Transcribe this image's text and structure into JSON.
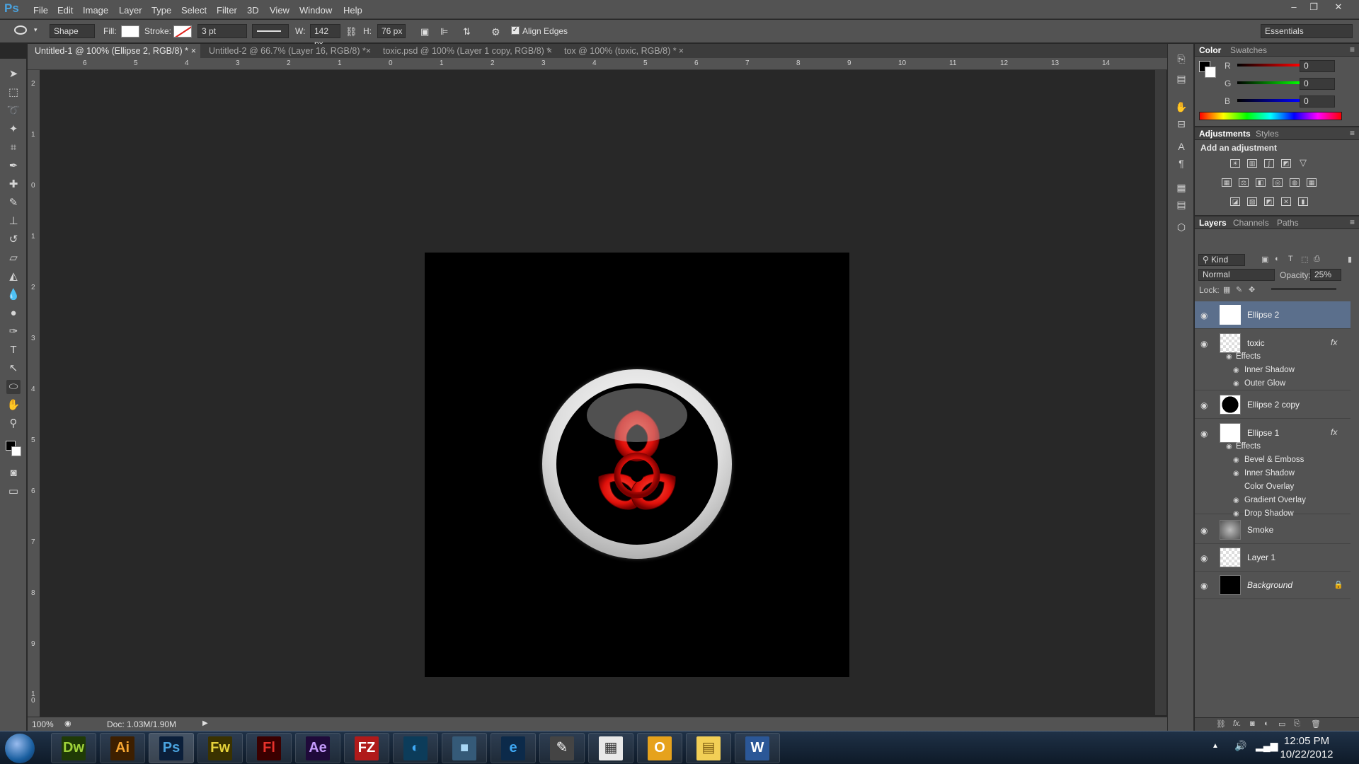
{
  "app": {
    "logo": "Ps",
    "accent": "#4aa3df"
  },
  "menu": [
    "File",
    "Edit",
    "Image",
    "Layer",
    "Type",
    "Select",
    "Filter",
    "3D",
    "View",
    "Window",
    "Help"
  ],
  "window_controls": {
    "minimize": "–",
    "restore": "❐",
    "close": "✕"
  },
  "options": {
    "tool_mode": "Shape",
    "fill_label": "Fill:",
    "stroke_label": "Stroke:",
    "stroke_width": "3 pt",
    "w_label": "W:",
    "width": "142 px",
    "h_label": "H:",
    "height": "76 px",
    "align_edges": "Align Edges",
    "workspace": "Essentials"
  },
  "tabs": [
    {
      "label": "Untitled-1 @ 100% (Ellipse 2, RGB/8) *",
      "active": true
    },
    {
      "label": "Untitled-2 @ 66.7% (Layer 16, RGB/8) *"
    },
    {
      "label": "toxic.psd @ 100% (Layer 1 copy, RGB/8) *"
    },
    {
      "label": "tox @ 100% (toxic, RGB/8) *"
    }
  ],
  "ruler_h": [
    "6",
    "5",
    "4",
    "3",
    "2",
    "1",
    "0",
    "1",
    "2",
    "3",
    "4",
    "5",
    "6",
    "7",
    "8",
    "9",
    "10",
    "11",
    "12",
    "13",
    "14"
  ],
  "ruler_v": [
    "2",
    "1",
    "0",
    "1",
    "2",
    "3",
    "4",
    "5",
    "6",
    "7",
    "8",
    "9",
    "1 0"
  ],
  "status": {
    "zoom": "100%",
    "doc": "Doc: 1.03M/1.90M"
  },
  "color_panel": {
    "tabs": [
      "Color",
      "Swatches"
    ],
    "channels": [
      {
        "label": "R",
        "value": "0"
      },
      {
        "label": "G",
        "value": "0"
      },
      {
        "label": "B",
        "value": "0"
      }
    ]
  },
  "adjustments_panel": {
    "tabs": [
      "Adjustments",
      "Styles"
    ],
    "heading": "Add an adjustment"
  },
  "layers_panel": {
    "tabs": [
      "Layers",
      "Channels",
      "Paths"
    ],
    "filter_kind": "Kind",
    "blend_mode": "Normal",
    "opacity_label": "Opacity:",
    "opacity": "25%",
    "lock_label": "Lock:",
    "layers": [
      {
        "name": "Ellipse 2",
        "selected": true
      },
      {
        "name": "toxic",
        "fx": "fx",
        "effects_label": "Effects",
        "effects": [
          "Inner Shadow",
          "Outer Glow"
        ]
      },
      {
        "name": "Ellipse 2 copy"
      },
      {
        "name": "Ellipse 1",
        "fx": "fx",
        "effects_label": "Effects",
        "effects": [
          "Bevel & Emboss",
          "Inner Shadow",
          "Color Overlay",
          "Gradient Overlay",
          "Drop Shadow"
        ]
      },
      {
        "name": "Smoke"
      },
      {
        "name": "Layer 1"
      },
      {
        "name": "Background"
      }
    ]
  },
  "taskbar": {
    "apps": [
      {
        "icon": "Dw",
        "color": "#9fd23a",
        "bg": "#1f3a06"
      },
      {
        "icon": "Ai",
        "color": "#f7a631",
        "bg": "#3d1f00"
      },
      {
        "icon": "Ps",
        "color": "#4aa3df",
        "bg": "#0b1f3a"
      },
      {
        "icon": "Fw",
        "color": "#e6d23b",
        "bg": "#3a3200"
      },
      {
        "icon": "Fl",
        "color": "#e8322b",
        "bg": "#3a0000"
      },
      {
        "icon": "Ae",
        "color": "#c49bfb",
        "bg": "#1f0a3a"
      },
      {
        "icon": "FZ",
        "color": "#ffffff",
        "bg": "#b01a1a"
      },
      {
        "icon": "◐",
        "color": "#3fa9f5",
        "bg": "#0c3c5a"
      },
      {
        "icon": "■",
        "color": "#a9d7f5",
        "bg": "#355a78"
      },
      {
        "icon": "e",
        "color": "#3fa9f5",
        "bg": "#0c2a4a"
      },
      {
        "icon": "✎",
        "color": "#ffffff",
        "bg": "#444"
      },
      {
        "icon": "▦",
        "color": "#333333",
        "bg": "#e8e8e8"
      },
      {
        "icon": "O",
        "color": "#ffffff",
        "bg": "#e6a21c"
      },
      {
        "icon": "▤",
        "color": "#7a5a10",
        "bg": "#f2cf56"
      },
      {
        "icon": "W",
        "color": "#ffffff",
        "bg": "#2b5797"
      }
    ],
    "time": "12:05 PM",
    "date": "10/22/2012"
  }
}
